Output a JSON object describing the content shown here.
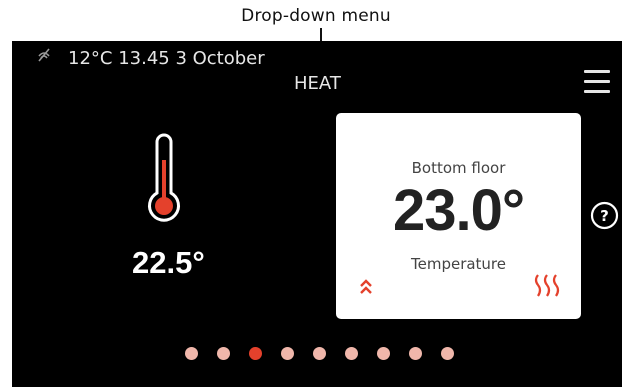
{
  "annotation": {
    "label": "Drop-down menu"
  },
  "status": {
    "text": "12°C 13.45 3 October",
    "icon": "wireless-off-icon"
  },
  "header": {
    "title": "HEAT",
    "menu_icon": "hamburger-menu-icon"
  },
  "thermometer": {
    "value": "22.5°",
    "icon": "thermometer-icon"
  },
  "card": {
    "title": "Bottom floor",
    "value": "23.0°",
    "label": "Temperature",
    "left_icon": "double-chevron-up-icon",
    "right_icon": "heat-waves-icon"
  },
  "help": {
    "icon": "help-icon",
    "glyph": "?"
  },
  "pager": {
    "count": 9,
    "active_index": 2
  },
  "colors": {
    "accent": "#e4412c",
    "dot_inactive": "#f0b7ab",
    "screen_bg": "#000000",
    "card_bg": "#ffffff"
  }
}
